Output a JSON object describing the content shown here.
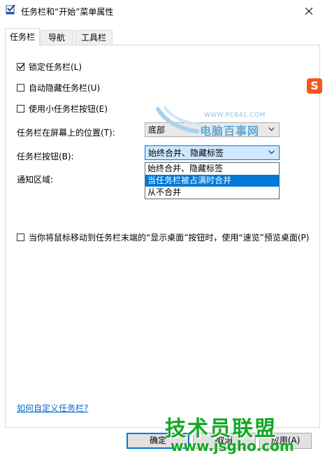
{
  "window": {
    "title": "任务栏和“开始”菜单属性"
  },
  "tabs": [
    {
      "label": "任务栏",
      "active": true
    },
    {
      "label": "导航",
      "active": false
    },
    {
      "label": "工具栏",
      "active": false
    }
  ],
  "options": {
    "lock_taskbar": {
      "label": "锁定任务栏(L)",
      "checked": true
    },
    "auto_hide": {
      "label": "自动隐藏任务栏(U)",
      "checked": false
    },
    "small_buttons": {
      "label": "使用小任务栏按钮(E)",
      "checked": false
    },
    "peek": {
      "label": "当你将鼠标移动到任务栏末端的“显示桌面”按钮时，使用“速览”预览桌面(P)",
      "checked": false
    }
  },
  "position": {
    "label": "任务栏在屏幕上的位置(T):",
    "value": "底部"
  },
  "buttons_combine": {
    "label": "任务栏按钮(B):",
    "value": "始终合并、隐藏标签",
    "options": [
      "始终合并、隐藏标签",
      "当任务栏被占满时合并",
      "从不合并"
    ],
    "highlighted_index": 1
  },
  "notification": {
    "label": "通知区域:"
  },
  "help_link": "如何自定义任务栏?",
  "footer": {
    "ok": "确定",
    "cancel": "取消",
    "apply": "应用(A)"
  },
  "watermarks": {
    "pc841_url": "WWW.PC841.COM",
    "pc841_name": "电脑百事网",
    "sogou": "S",
    "jsgho_name": "技术员联盟",
    "jsgho_url": "www.jsgho.com"
  },
  "colors": {
    "accent": "#0078d7",
    "link": "#0066cc",
    "watermark_green": "#15a825"
  }
}
